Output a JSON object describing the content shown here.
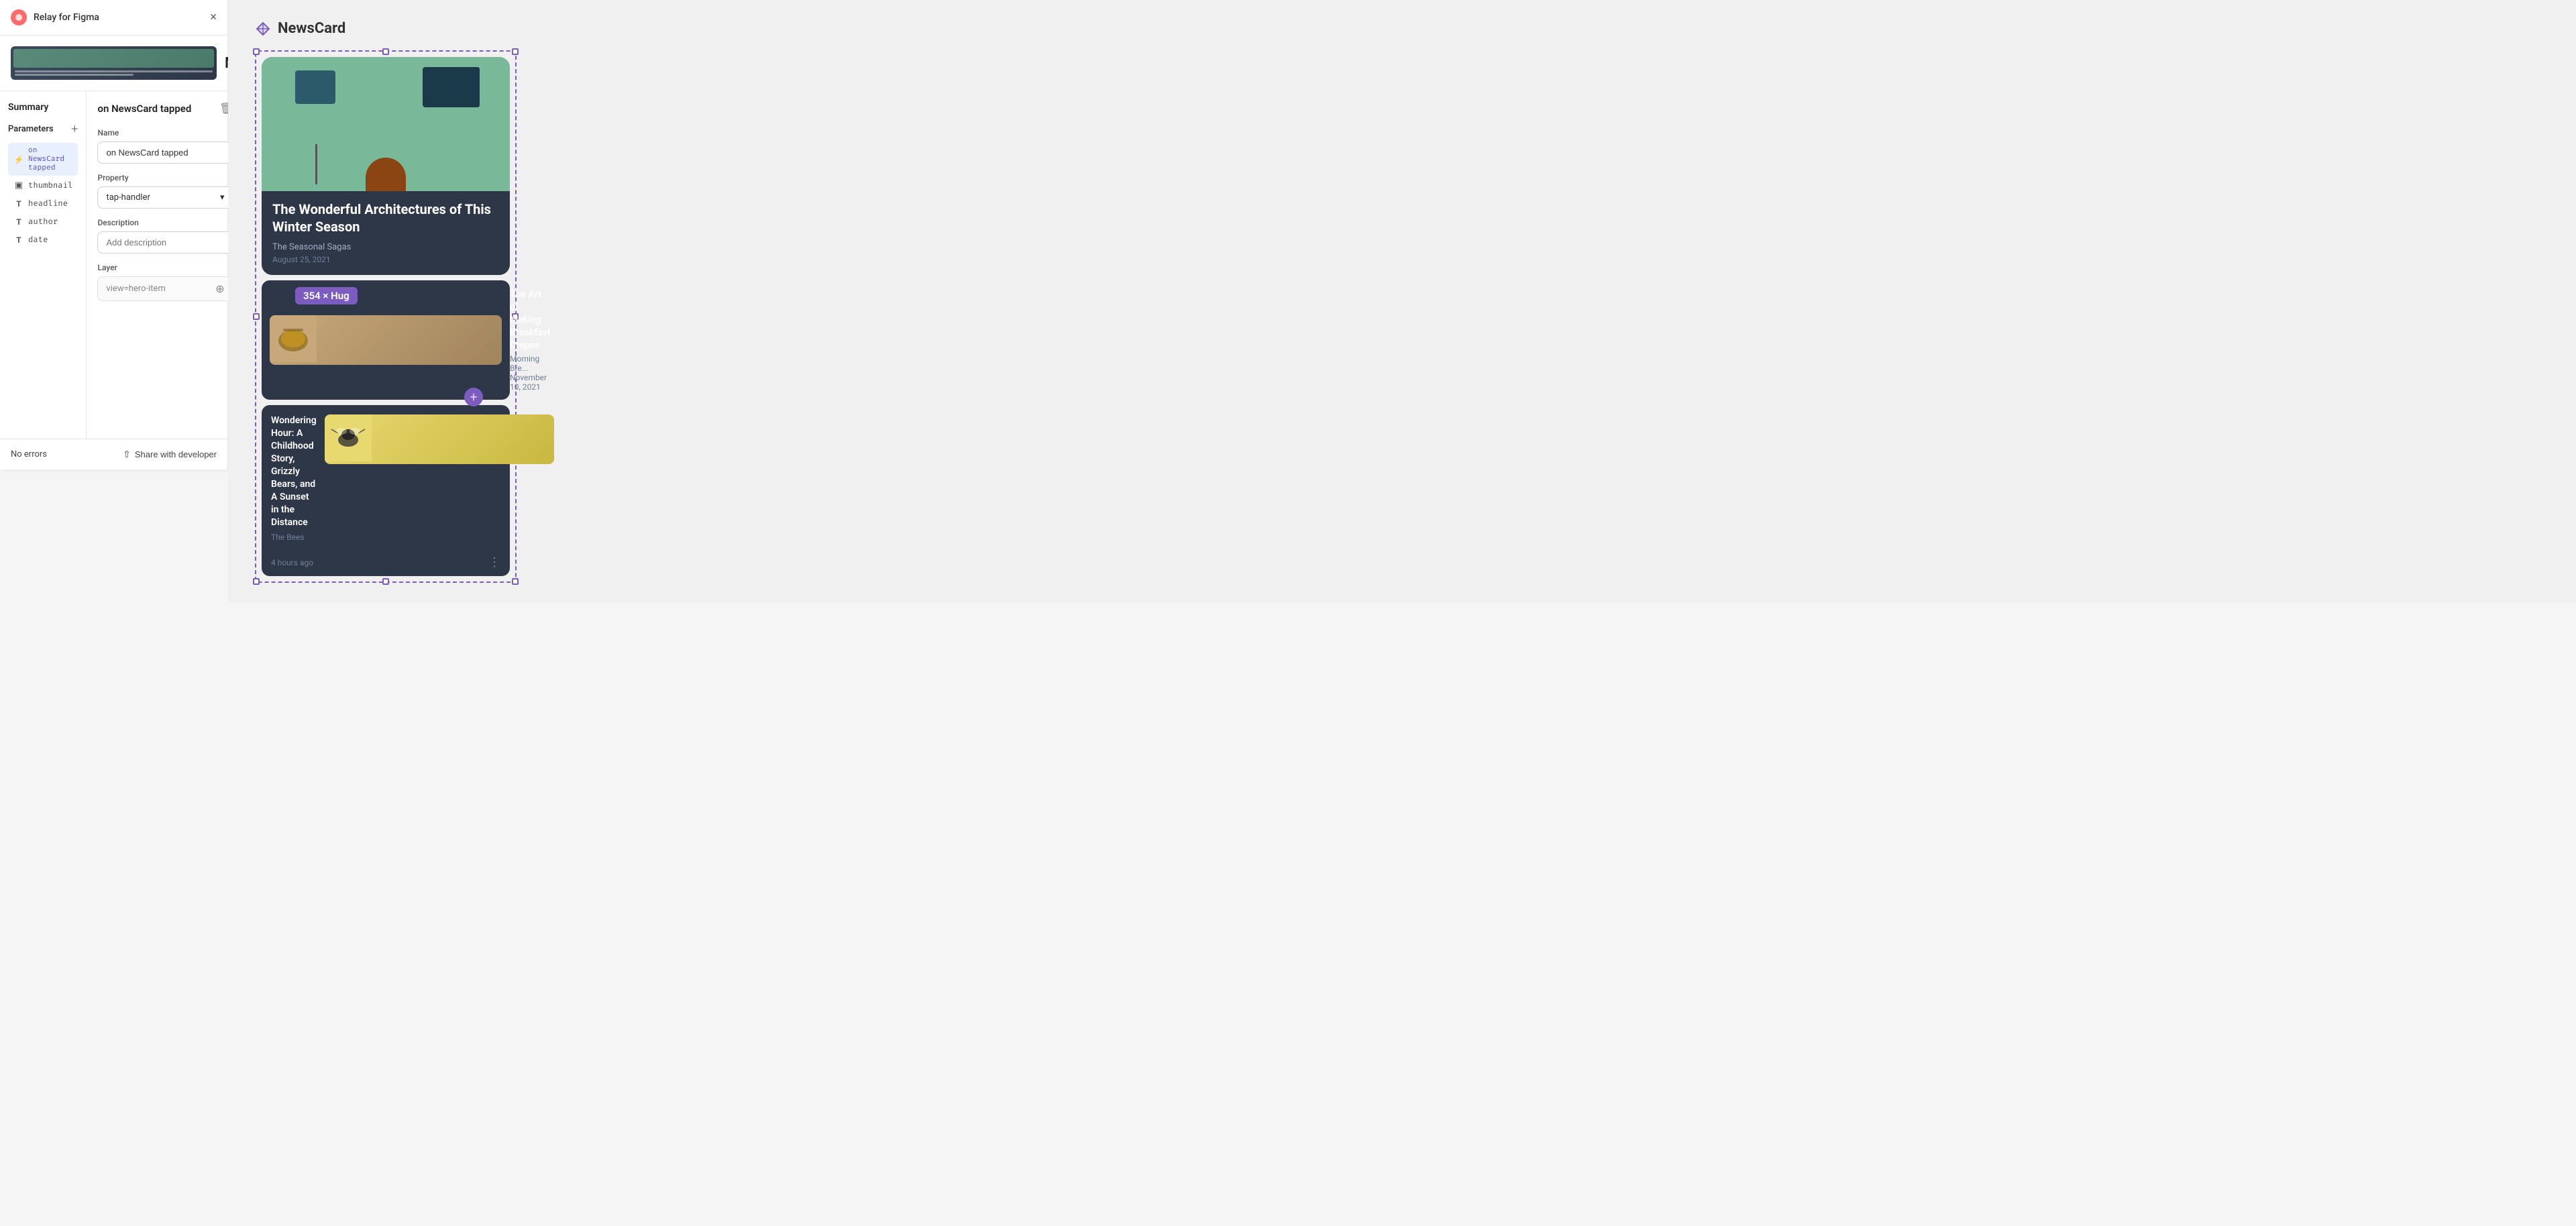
{
  "app": {
    "name": "Relay for Figma",
    "close_label": "×"
  },
  "component": {
    "name": "NewsCard",
    "more_icon": "⋮"
  },
  "left_panel": {
    "summary_label": "Summary",
    "parameters_label": "Parameters",
    "add_icon": "+",
    "params": [
      {
        "id": "on-newscard-tapped",
        "icon_type": "event",
        "icon": "⚡",
        "label": "on NewsCard tapped",
        "active": true
      },
      {
        "id": "thumbnail",
        "icon_type": "image",
        "icon": "▣",
        "label": "thumbnail",
        "active": false
      },
      {
        "id": "headline",
        "icon_type": "text",
        "icon": "T",
        "label": "headline",
        "active": false
      },
      {
        "id": "author",
        "icon_type": "text",
        "icon": "T",
        "label": "author",
        "active": false
      },
      {
        "id": "date",
        "icon_type": "text",
        "icon": "T",
        "label": "date",
        "active": false
      }
    ]
  },
  "detail_panel": {
    "title": "on NewsCard tapped",
    "delete_icon": "🗑",
    "fields": {
      "name_label": "Name",
      "name_value": "on NewsCard tapped",
      "property_label": "Property",
      "property_value": "tap-handler",
      "property_chevron": "▾",
      "description_label": "Description",
      "description_placeholder": "Add description",
      "layer_label": "Layer",
      "layer_value": "view=hero-item",
      "target_icon": "⊕"
    }
  },
  "footer": {
    "no_errors": "No errors",
    "share_label": "Share with developer",
    "share_icon": "⇧"
  },
  "canvas": {
    "title": "NewsCard",
    "hero_card": {
      "title": "The Wonderful Architectures of This Winter Season",
      "author": "The Seasonal Sagas",
      "date": "August 25, 2021"
    },
    "small_cards": [
      {
        "title": "The Art of Making Breakfast Crepes",
        "meta": "Morning Bre...",
        "date": "November 10, 2021",
        "size_badge": "354 × Hug"
      },
      {
        "title": "Wondering Hour: A Childhood Story, Grizzly Bears, and A Sunset in the Distance",
        "author": "The Bees",
        "time": "4 hours ago",
        "more_icon": "⋮"
      }
    ]
  }
}
